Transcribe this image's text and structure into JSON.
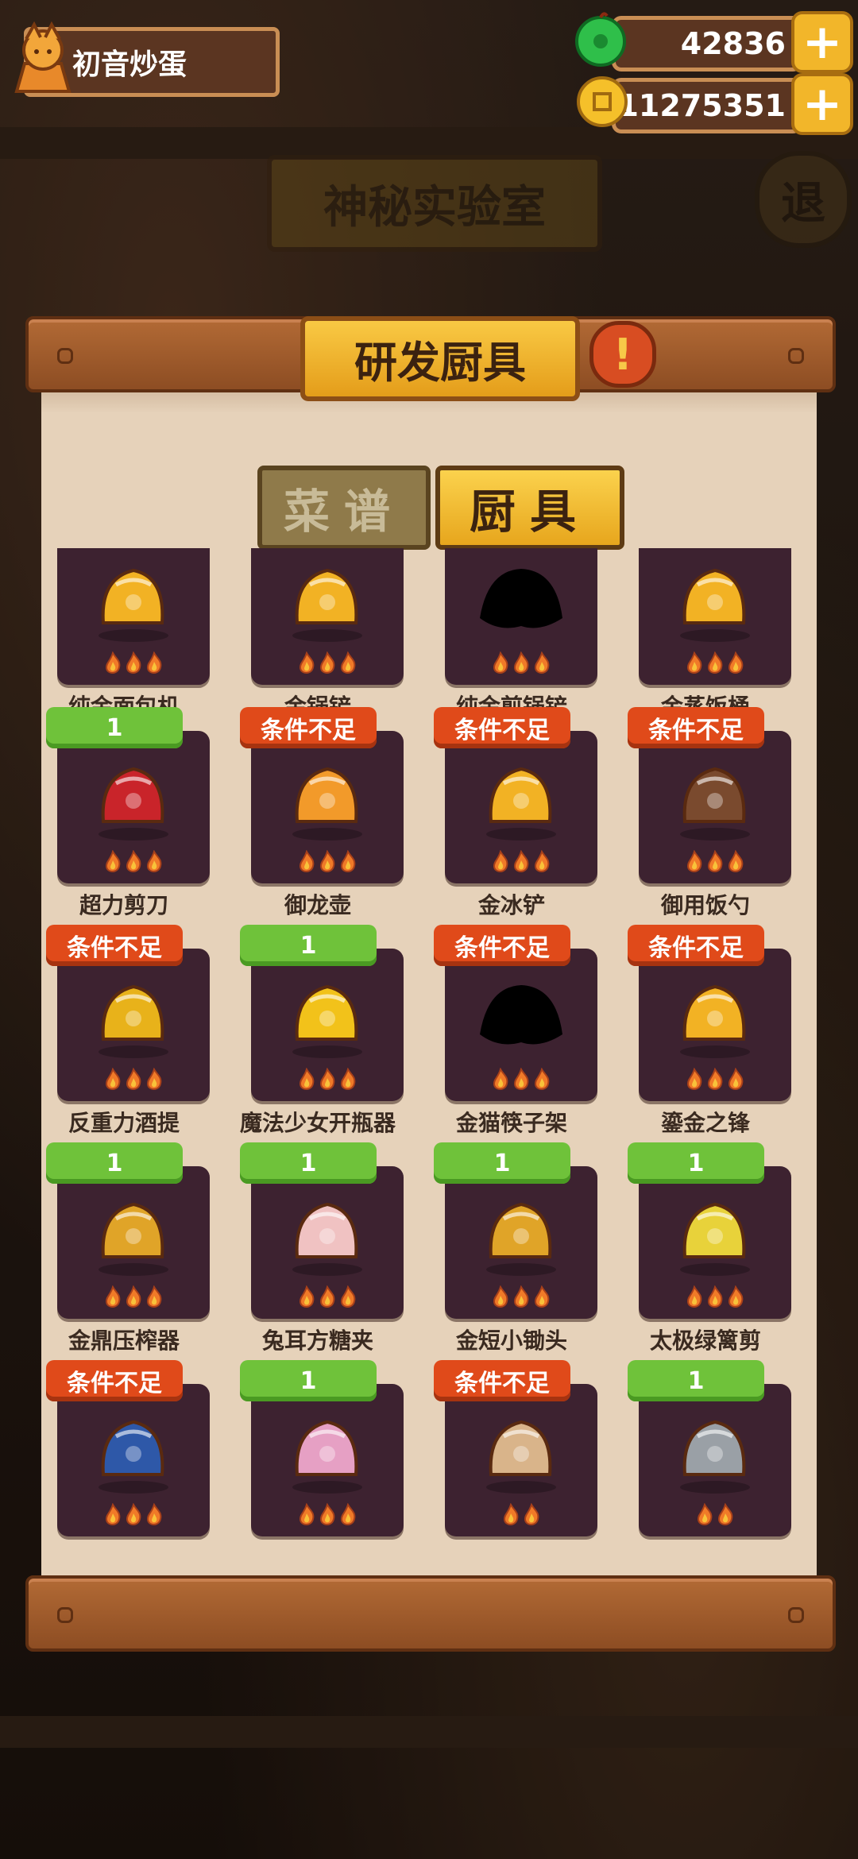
{
  "player": {
    "name": "初音炒蛋"
  },
  "currencies": {
    "jade": {
      "value": "42836",
      "icon": "jade-icon"
    },
    "coin": {
      "value": "11275351",
      "icon": "coin-icon"
    }
  },
  "background": {
    "title": "神秘实验室",
    "exit_label": "退"
  },
  "panel": {
    "title": "研发厨具",
    "info_label": "!"
  },
  "tabs": [
    {
      "label": "菜谱",
      "active": false
    },
    {
      "label": "厨具",
      "active": true
    }
  ],
  "items": [
    {
      "name": "纯金面包机",
      "badge": "",
      "stars": 3,
      "icon": "golden-bread-machine-icon",
      "color": "#f2b224"
    },
    {
      "name": "金锅铲",
      "badge": "",
      "stars": 3,
      "icon": "golden-spatula-icon",
      "color": "#f2b224"
    },
    {
      "name": "纯金煎锅铲",
      "badge": "",
      "stars": 3,
      "icon": "locked-silhouette-icon",
      "color": "#000000"
    },
    {
      "name": "金蒸饭桶",
      "badge": "",
      "stars": 3,
      "icon": "golden-rice-steamer-icon",
      "color": "#f2b224"
    },
    {
      "name": "超力剪刀",
      "badge": "1",
      "stars": 3,
      "icon": "scissors-icon",
      "color": "#c9242a"
    },
    {
      "name": "御龙壶",
      "badge": "条件不足",
      "stars": 3,
      "icon": "dragon-teapot-icon",
      "color": "#f29a2a"
    },
    {
      "name": "金冰铲",
      "badge": "条件不足",
      "stars": 3,
      "icon": "golden-ice-scoop-icon",
      "color": "#f2b224"
    },
    {
      "name": "御用饭勺",
      "badge": "条件不足",
      "stars": 3,
      "icon": "rice-ladle-icon",
      "color": "#7a4a2e"
    },
    {
      "name": "反重力酒提",
      "badge": "条件不足",
      "stars": 3,
      "icon": "wine-dipper-icon",
      "color": "#e8b21a"
    },
    {
      "name": "魔法少女开瓶器",
      "badge": "1",
      "stars": 3,
      "icon": "magic-opener-icon",
      "color": "#f2c21a"
    },
    {
      "name": "金猫筷子架",
      "badge": "条件不足",
      "stars": 3,
      "icon": "locked-silhouette-icon",
      "color": "#000000"
    },
    {
      "name": "鎏金之锋",
      "badge": "条件不足",
      "stars": 3,
      "icon": "gilded-blade-icon",
      "color": "#f2b224"
    },
    {
      "name": "金鼎压榨器",
      "badge": "1",
      "stars": 3,
      "icon": "golden-press-icon",
      "color": "#e0a428"
    },
    {
      "name": "兔耳方糖夹",
      "badge": "1",
      "stars": 3,
      "icon": "bunny-tongs-icon",
      "color": "#f0c2c2"
    },
    {
      "name": "金短小锄头",
      "badge": "1",
      "stars": 3,
      "icon": "golden-hoe-icon",
      "color": "#e0a428"
    },
    {
      "name": "太极绿篱剪",
      "badge": "1",
      "stars": 3,
      "icon": "taiji-shears-icon",
      "color": "#e8d23a"
    },
    {
      "name": "",
      "badge": "条件不足",
      "stars": 3,
      "icon": "pepper-shaker-icon",
      "color": "#2e58a8"
    },
    {
      "name": "",
      "badge": "1",
      "stars": 3,
      "icon": "pink-gadget-icon",
      "color": "#e6a0c4"
    },
    {
      "name": "",
      "badge": "条件不足",
      "stars": 2,
      "icon": "toaster-icon",
      "color": "#d9b48a"
    },
    {
      "name": "",
      "badge": "1",
      "stars": 2,
      "icon": "metal-spatula-icon",
      "color": "#9aa0a6"
    }
  ]
}
